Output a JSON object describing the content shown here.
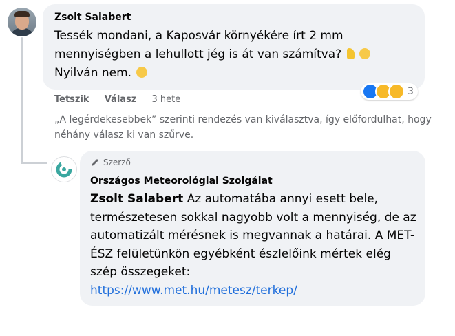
{
  "comment1": {
    "author": "Zsolt Salabert",
    "text": "Tessék mondani, a Kaposvár környékére írt 2 mm mennyiségben a lehullott jég is át van számítva?",
    "text2": "Nyilván nem.",
    "actions": {
      "like": "Tetszik",
      "reply": "Válasz",
      "time": "3 hete"
    },
    "reactions": {
      "icons": [
        "like",
        "haha",
        "sad"
      ],
      "count": "3"
    }
  },
  "sort_note": "„A legérdekesebbek” szerinti rendezés van kiválasztva, így előfordulhat, hogy néhány válasz ki van szűrve.",
  "reply": {
    "badge": "Szerző",
    "author": "Országos Meteorológiai Szolgálat",
    "mention": "Zsolt Salabert",
    "text": " Az automatába annyi esett bele, természetesen sokkal nagyobb volt a mennyiség, de az automatizált mérésnek is megvannak a határai. A MET-ÉSZ felületünkön egyébként észlelőink mértek elég szép összegeket:",
    "link": "https://www.met.hu/metesz/terkep/"
  },
  "colors": {
    "bubble": "#f0f2f5",
    "link": "#216fdb",
    "secondary_text": "#65676b",
    "like_blue": "#1877f2"
  }
}
